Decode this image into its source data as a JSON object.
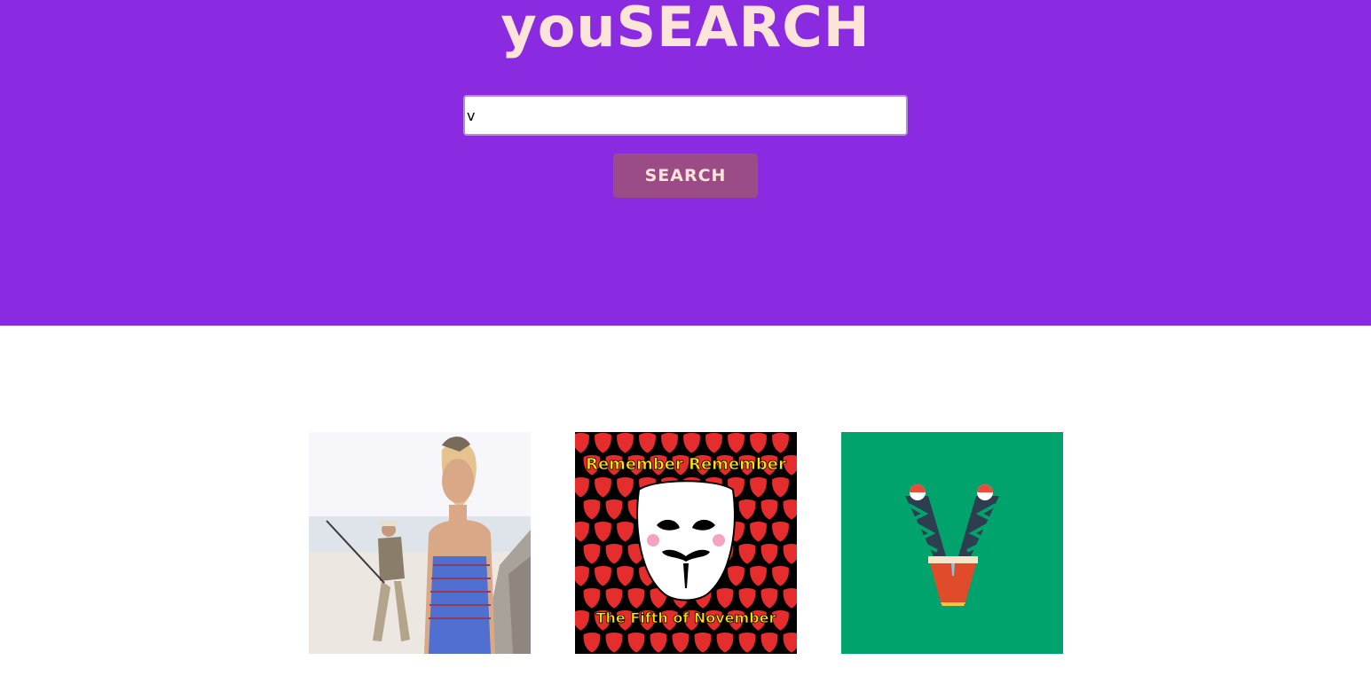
{
  "header": {
    "logo": "youSEARCH"
  },
  "search": {
    "value": "v",
    "button_label": "SEARCH"
  },
  "results": [
    {
      "subject": "woman in swimsuit with man fishing at beach"
    },
    {
      "subject": "mask poster",
      "caption_top": "Remember Remember",
      "caption_bottom": "The Fifth of November"
    },
    {
      "subject": "letter V illustration on green background"
    }
  ],
  "colors": {
    "hero": "#8a2be2",
    "logo": "#fce4d8",
    "button": "#9b4b86",
    "v_background": "#00a36c"
  }
}
